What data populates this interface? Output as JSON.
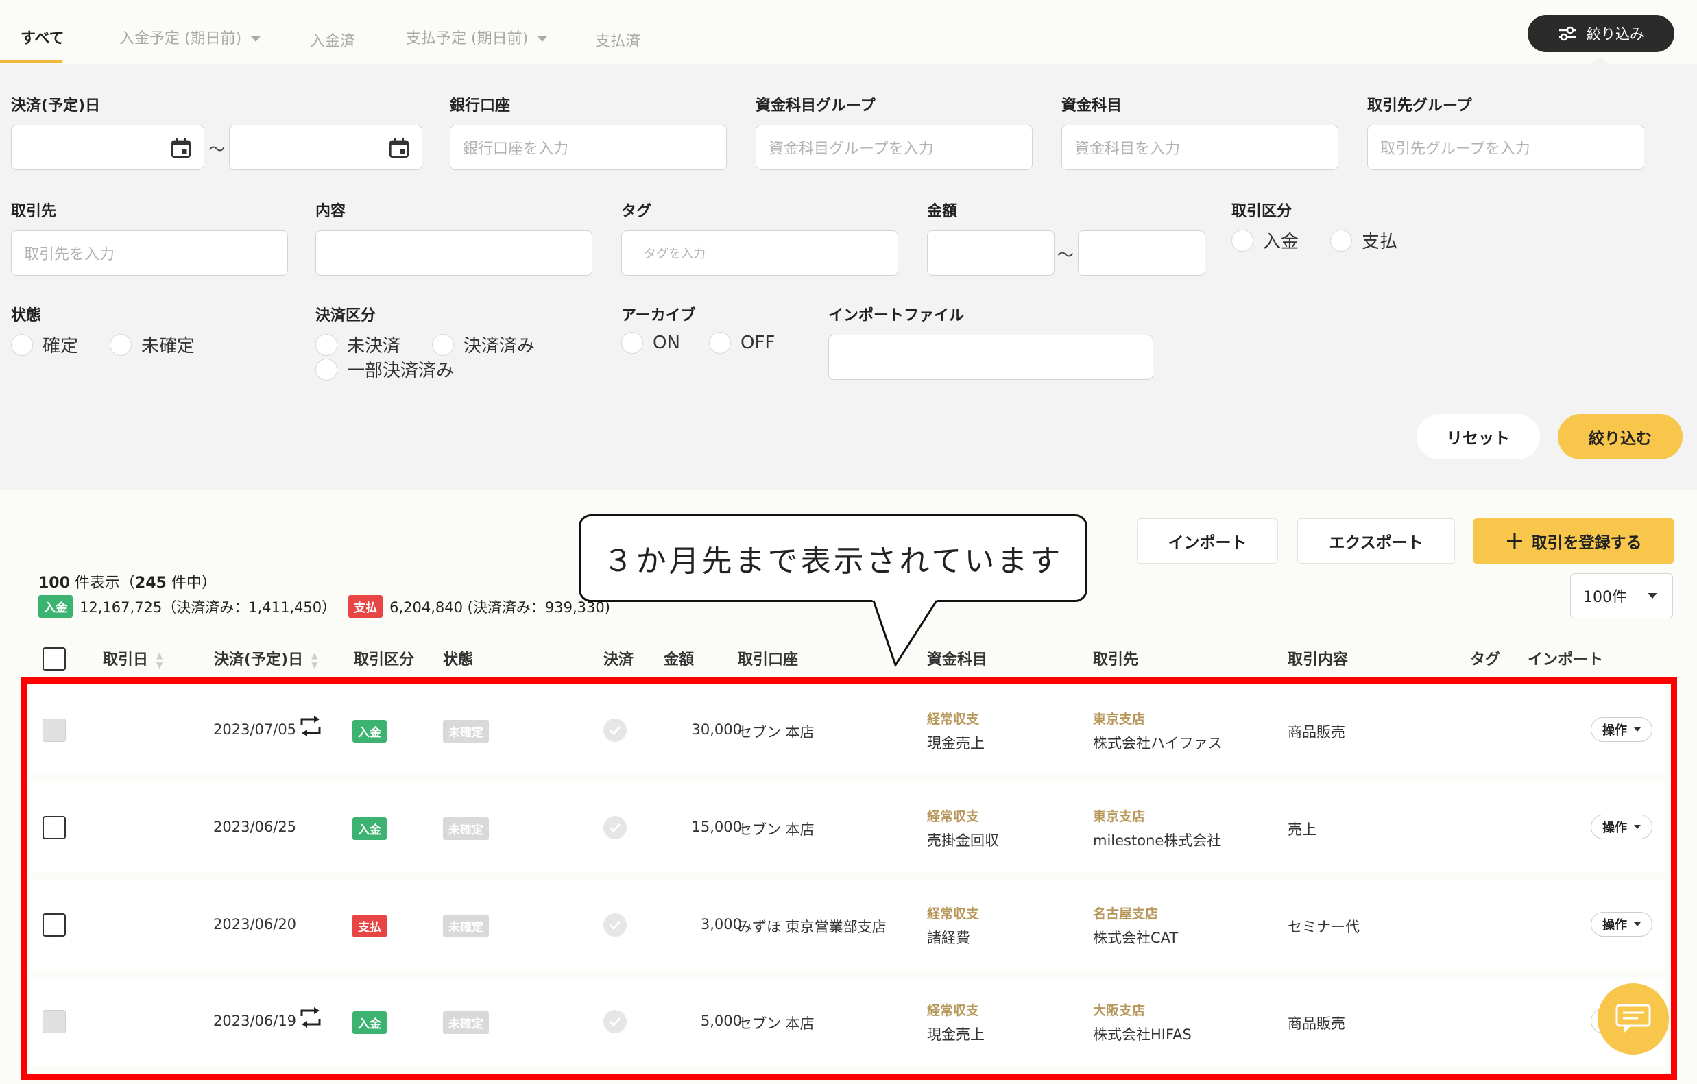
{
  "tabs": [
    {
      "label": "すべて",
      "active": true
    },
    {
      "label": "入金予定 (期日前)",
      "dropdown": true
    },
    {
      "label": "入金済"
    },
    {
      "label": "支払予定 (期日前)",
      "dropdown": true
    },
    {
      "label": "支払済"
    }
  ],
  "filter_toggle_label": "絞り込み",
  "filters": {
    "settle_date_label": "決済(予定)日",
    "tilde": "〜",
    "bank_label": "銀行口座",
    "bank_placeholder": "銀行口座を入力",
    "fund_group_label": "資金科目グループ",
    "fund_group_placeholder": "資金科目グループを入力",
    "fund_label": "資金科目",
    "fund_placeholder": "資金科目を入力",
    "partner_group_label": "取引先グループ",
    "partner_group_placeholder": "取引先グループを入力",
    "partner_label": "取引先",
    "partner_placeholder": "取引先を入力",
    "content_label": "内容",
    "tag_label": "タグ",
    "tag_placeholder": "タグを入力",
    "amount_label": "金額",
    "type_label": "取引区分",
    "type_options": [
      "入金",
      "支払"
    ],
    "status_label": "状態",
    "status_options": [
      "確定",
      "未確定"
    ],
    "settle_type_label": "決済区分",
    "settle_type_options": [
      "未決済",
      "決済済み",
      "一部決済済み"
    ],
    "archive_label": "アーカイブ",
    "archive_options": [
      "ON",
      "OFF"
    ],
    "import_file_label": "インポートファイル",
    "reset_label": "リセット",
    "apply_label": "絞り込む"
  },
  "actions": {
    "import_label": "インポート",
    "export_label": "エクスポート",
    "register_label": "取引を登録する",
    "per_page": "100件"
  },
  "summary": {
    "count_shown": "100",
    "count_shown_suffix": " 件表示（",
    "count_total": "245",
    "count_total_suffix": " 件中）",
    "income_badge": "入金",
    "income_text": "12,167,725（決済済み：1,411,450）",
    "expense_badge": "支払",
    "expense_text": "6,204,840 (決済済み：939,330)"
  },
  "callout_text": "３か月先まで表示されています",
  "table": {
    "headers": {
      "date": "取引日",
      "settle_date": "決済(予定)日",
      "type": "取引区分",
      "status": "状態",
      "settled": "決済",
      "amount": "金額",
      "bank": "取引口座",
      "fund": "資金科目",
      "partner": "取引先",
      "content": "取引内容",
      "tag": "タグ",
      "import": "インポート"
    },
    "rows": [
      {
        "settle_date": "2023/07/05",
        "recurring": true,
        "type": "入金",
        "status": "未確定",
        "amount": "30,000",
        "bank": "セブン 本店",
        "fund_group": "経常収支",
        "fund": "現金売上",
        "partner_group": "東京支店",
        "partner": "株式会社ハイファス",
        "content": "商品販売",
        "op": "操作",
        "checkbox_disabled": true
      },
      {
        "settle_date": "2023/06/25",
        "recurring": false,
        "type": "入金",
        "status": "未確定",
        "amount": "15,000",
        "bank": "セブン 本店",
        "fund_group": "経常収支",
        "fund": "売掛金回収",
        "partner_group": "東京支店",
        "partner": "milestone株式会社",
        "content": "売上",
        "op": "操作",
        "checkbox_disabled": false
      },
      {
        "settle_date": "2023/06/20",
        "recurring": false,
        "type": "支払",
        "status": "未確定",
        "amount": "3,000",
        "bank": "みずほ 東京営業部支店",
        "fund_group": "経常収支",
        "fund": "諸経費",
        "partner_group": "名古屋支店",
        "partner": "株式会社CAT",
        "content": "セミナー代",
        "op": "操作",
        "checkbox_disabled": false
      },
      {
        "settle_date": "2023/06/19",
        "recurring": true,
        "type": "入金",
        "status": "未確定",
        "amount": "5,000",
        "bank": "セブン 本店",
        "fund_group": "経常収支",
        "fund": "現金売上",
        "partner_group": "大阪支店",
        "partner": "株式会社HIFAS",
        "content": "商品販売",
        "op": "操作",
        "checkbox_disabled": true
      }
    ]
  },
  "colors": {
    "accent": "#f7c64a",
    "income": "#3cb371",
    "expense": "#e84545",
    "highlight": "#ff0000"
  }
}
